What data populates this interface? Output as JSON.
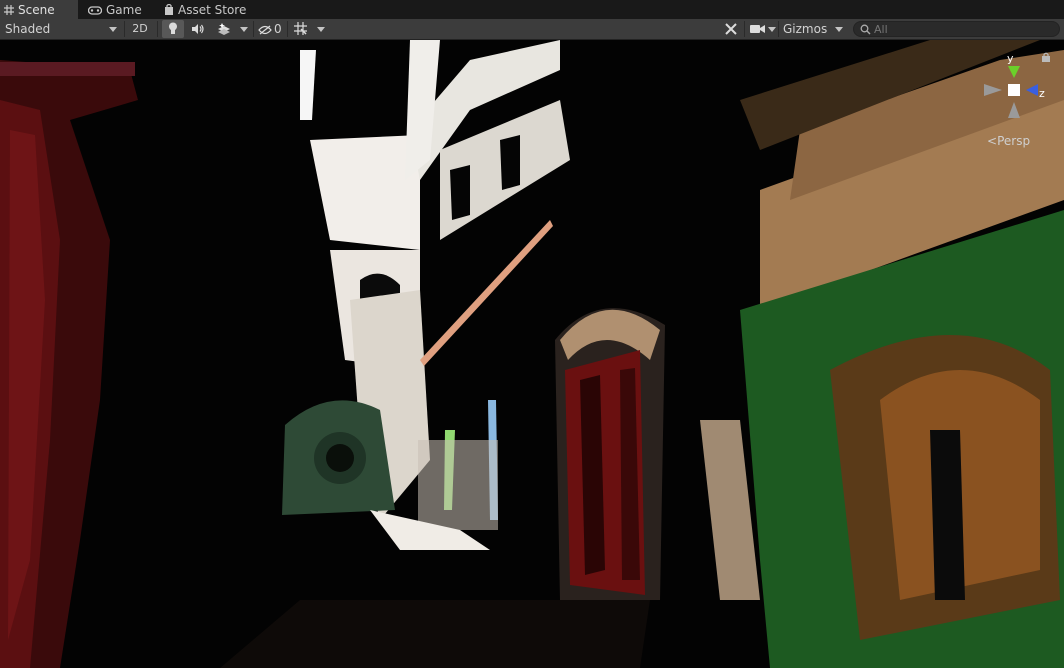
{
  "tabs": [
    {
      "label": "Scene",
      "icon": "grid-icon",
      "active": true
    },
    {
      "label": "Game",
      "icon": "gamepad-icon",
      "active": false
    },
    {
      "label": "Asset Store",
      "icon": "shopping-bag-icon",
      "active": false
    }
  ],
  "toolbar": {
    "draw_mode": "Shaded",
    "mode_2d": "2D",
    "lighting_icon": "lightbulb-icon",
    "audio_icon": "speaker-icon",
    "effects_icon": "effects-icon",
    "hidden_count": "0",
    "grid_icon": "grid-snap-icon",
    "tools_icon": "tools-icon",
    "camera_icon": "camera-icon",
    "gizmos_label": "Gizmos",
    "search_placeholder": "All"
  },
  "scene": {
    "projection_label": "Persp",
    "axis_y": "y",
    "axis_z": "z"
  },
  "colors": {
    "toolbar_bg": "#3c3c3c",
    "tabbar_bg": "#191919",
    "wall_green": "#1d5a21",
    "wall_wood": "#a37b52",
    "curtain_red": "#6e0f0f"
  }
}
